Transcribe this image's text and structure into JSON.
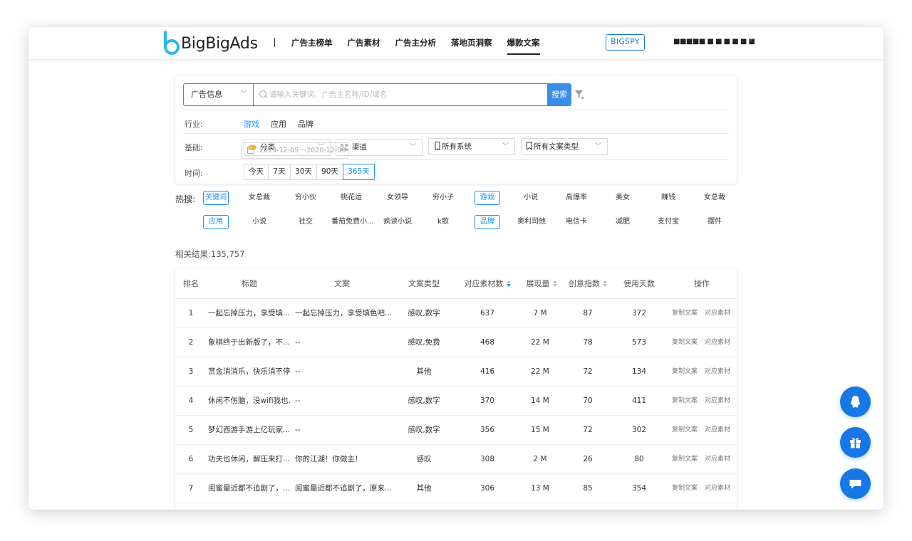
{
  "header": {
    "logo_text": "BigBigAds",
    "nav": [
      "广告主榜单",
      "广告素材",
      "广告主分析",
      "落地页洞察",
      "爆款文案"
    ],
    "active_nav": "爆款文案",
    "bigspy_label": "BIGSPY",
    "user_name": "■■■■■ ■ ■ ■ ■ ■ ■"
  },
  "search": {
    "type_select": "广告信息",
    "placeholder": "请输入关键词、广告主名称/ID/域名",
    "button": "搜索"
  },
  "filters": {
    "industry_label": "行业:",
    "industries": [
      "游戏",
      "应用",
      "品牌"
    ],
    "active_industry": "游戏",
    "basic_label": "基础:",
    "category": "分类",
    "channel": "渠道",
    "system": "所有系统",
    "copy_type": "所有文案类型",
    "time_label": "时间:",
    "time_options": [
      "今天",
      "7天",
      "30天",
      "90天",
      "365天"
    ],
    "active_time": "365天",
    "date_range": "2019-12-05 ~2020-12-03"
  },
  "hot": {
    "label": "热搜:",
    "row1": [
      "关键词",
      "女总裁",
      "穷小伙",
      "桃花运",
      "女领导",
      "穷小子",
      "游戏",
      "小说",
      "高爆率",
      "美女",
      "赚钱",
      "女总裁"
    ],
    "row2": [
      "应用",
      "小说",
      "社交",
      "番茄免费小...",
      "疯读小说",
      "k歌",
      "品牌",
      "奥利司他",
      "电信卡",
      "减肥",
      "支付宝",
      "摆件"
    ]
  },
  "results": {
    "label": "相关结果:135,757"
  },
  "table": {
    "headers": [
      "排名",
      "标题",
      "文案",
      "文案类型",
      "对应素材数",
      "展现量",
      "创意指数",
      "使用天数",
      "操作"
    ],
    "op_copy": "复制文案",
    "op_material": "对应素材",
    "rows": [
      {
        "rank": "1",
        "title": "一起忘掉压力，享受填...",
        "copy": "一起忘掉压力，享受填色吧...",
        "type": "感叹,数字",
        "materials": "637",
        "views": "7 M",
        "creative": "87",
        "days": "372"
      },
      {
        "rank": "2",
        "title": "象棋终于出新版了，不...",
        "copy": "--",
        "type": "感叹,免费",
        "materials": "468",
        "views": "22 M",
        "creative": "78",
        "days": "573"
      },
      {
        "rank": "3",
        "title": "赏金消消乐，快乐消不停",
        "copy": "--",
        "type": "其他",
        "materials": "416",
        "views": "22 M",
        "creative": "72",
        "days": "134"
      },
      {
        "rank": "4",
        "title": "休闲不伤脑，没wifi我也...",
        "copy": "--",
        "type": "感叹,数字",
        "materials": "370",
        "views": "14 M",
        "creative": "70",
        "days": "411"
      },
      {
        "rank": "5",
        "title": "梦幻西游手游上亿玩家...",
        "copy": "--",
        "type": "感叹,数字",
        "materials": "356",
        "views": "15 M",
        "creative": "72",
        "days": "302"
      },
      {
        "rank": "6",
        "title": "功夫也休闲，解压来打...",
        "copy": "你的江湖！你做主！",
        "type": "感叹",
        "materials": "308",
        "views": "2 M",
        "creative": "26",
        "days": "80"
      },
      {
        "rank": "7",
        "title": "闺蜜最近都不追剧了，...",
        "copy": "闺蜜最近都不追剧了，原来...",
        "type": "其他",
        "materials": "306",
        "views": "13 M",
        "creative": "85",
        "days": "354"
      }
    ]
  },
  "colors": {
    "accent": "#1890ff",
    "fab": "#1677e5",
    "logo": "#2fb7e8"
  },
  "fabs": [
    "qq-icon",
    "gift-icon",
    "chat-icon"
  ]
}
